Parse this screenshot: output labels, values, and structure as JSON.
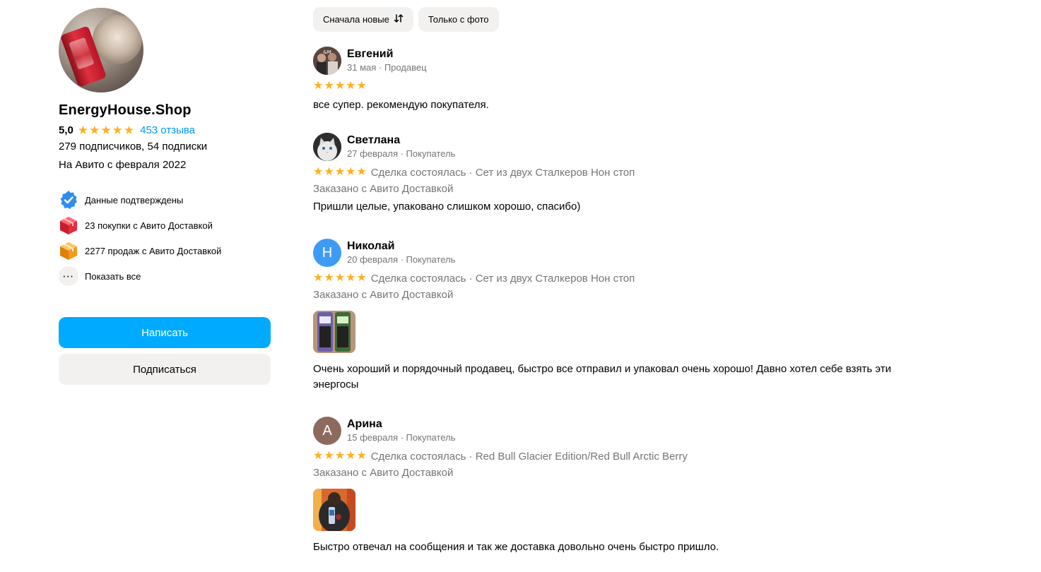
{
  "profile": {
    "name": "EnergyHouse.Shop",
    "rating": "5,0",
    "reviews_link": "453 отзыва",
    "followers": "279 подписчиков, 54 подписки",
    "since": "На Авито с февраля 2022",
    "badges": [
      {
        "icon": "verified-check-icon",
        "label": "Данные подтверждены"
      },
      {
        "icon": "red-box-icon",
        "label": "23 покупки с Авито Доставкой"
      },
      {
        "icon": "orange-box-icon",
        "label": "2277 продаж с Авито Доставкой"
      },
      {
        "icon": "more-dots-icon",
        "label": "Показать все"
      }
    ],
    "write_button": "Написать",
    "subscribe_button": "Подписаться"
  },
  "filters": {
    "sort": "Сначала новые",
    "photo_only": "Только с фото"
  },
  "reviews": [
    {
      "name": "Евгений",
      "meta": "31 мая · Продавец",
      "stars": 5,
      "deal": "",
      "delivery": "",
      "text": "все супер. рекомендую покупателя."
    },
    {
      "name": "Светлана",
      "meta": "27 февраля · Покупатель",
      "stars": 5,
      "deal": "Сделка состоялась · Сет из двух Сталкеров Нон стоп",
      "delivery": "Заказано с Авито Доставкой",
      "text": "Пришли целые, упаковано слишком хорошо, спасибо)"
    },
    {
      "name": "Николай",
      "initial": "Н",
      "meta": "20 февраля · Покупатель",
      "stars": 5,
      "deal": "Сделка состоялась · Сет из двух Сталкеров Нон стоп",
      "delivery": "Заказано с Авито Доставкой",
      "text": "Очень хороший и порядочный продавец, быстро все отправил и упаковал очень хорошо! Давно хотел себе взять эти энергосы"
    },
    {
      "name": "Арина",
      "initial": "А",
      "meta": "15 февраля · Покупатель",
      "stars": 5,
      "deal": "Сделка состоялась · Red Bull Glacier Edition/Red Bull Arctic Berry",
      "delivery": "Заказано с Авито Доставкой",
      "text": "Быстро отвечал на сообщения и так же доставка довольно очень быстро пришло."
    }
  ],
  "colors": {
    "accent": "#00aaff",
    "link": "#0099f7",
    "star": "#ffb021",
    "muted": "#757575",
    "chip_bg": "#f2f1f0",
    "avatar_nikolai": "#3d9bf5",
    "avatar_arina": "#8e6a5e"
  }
}
